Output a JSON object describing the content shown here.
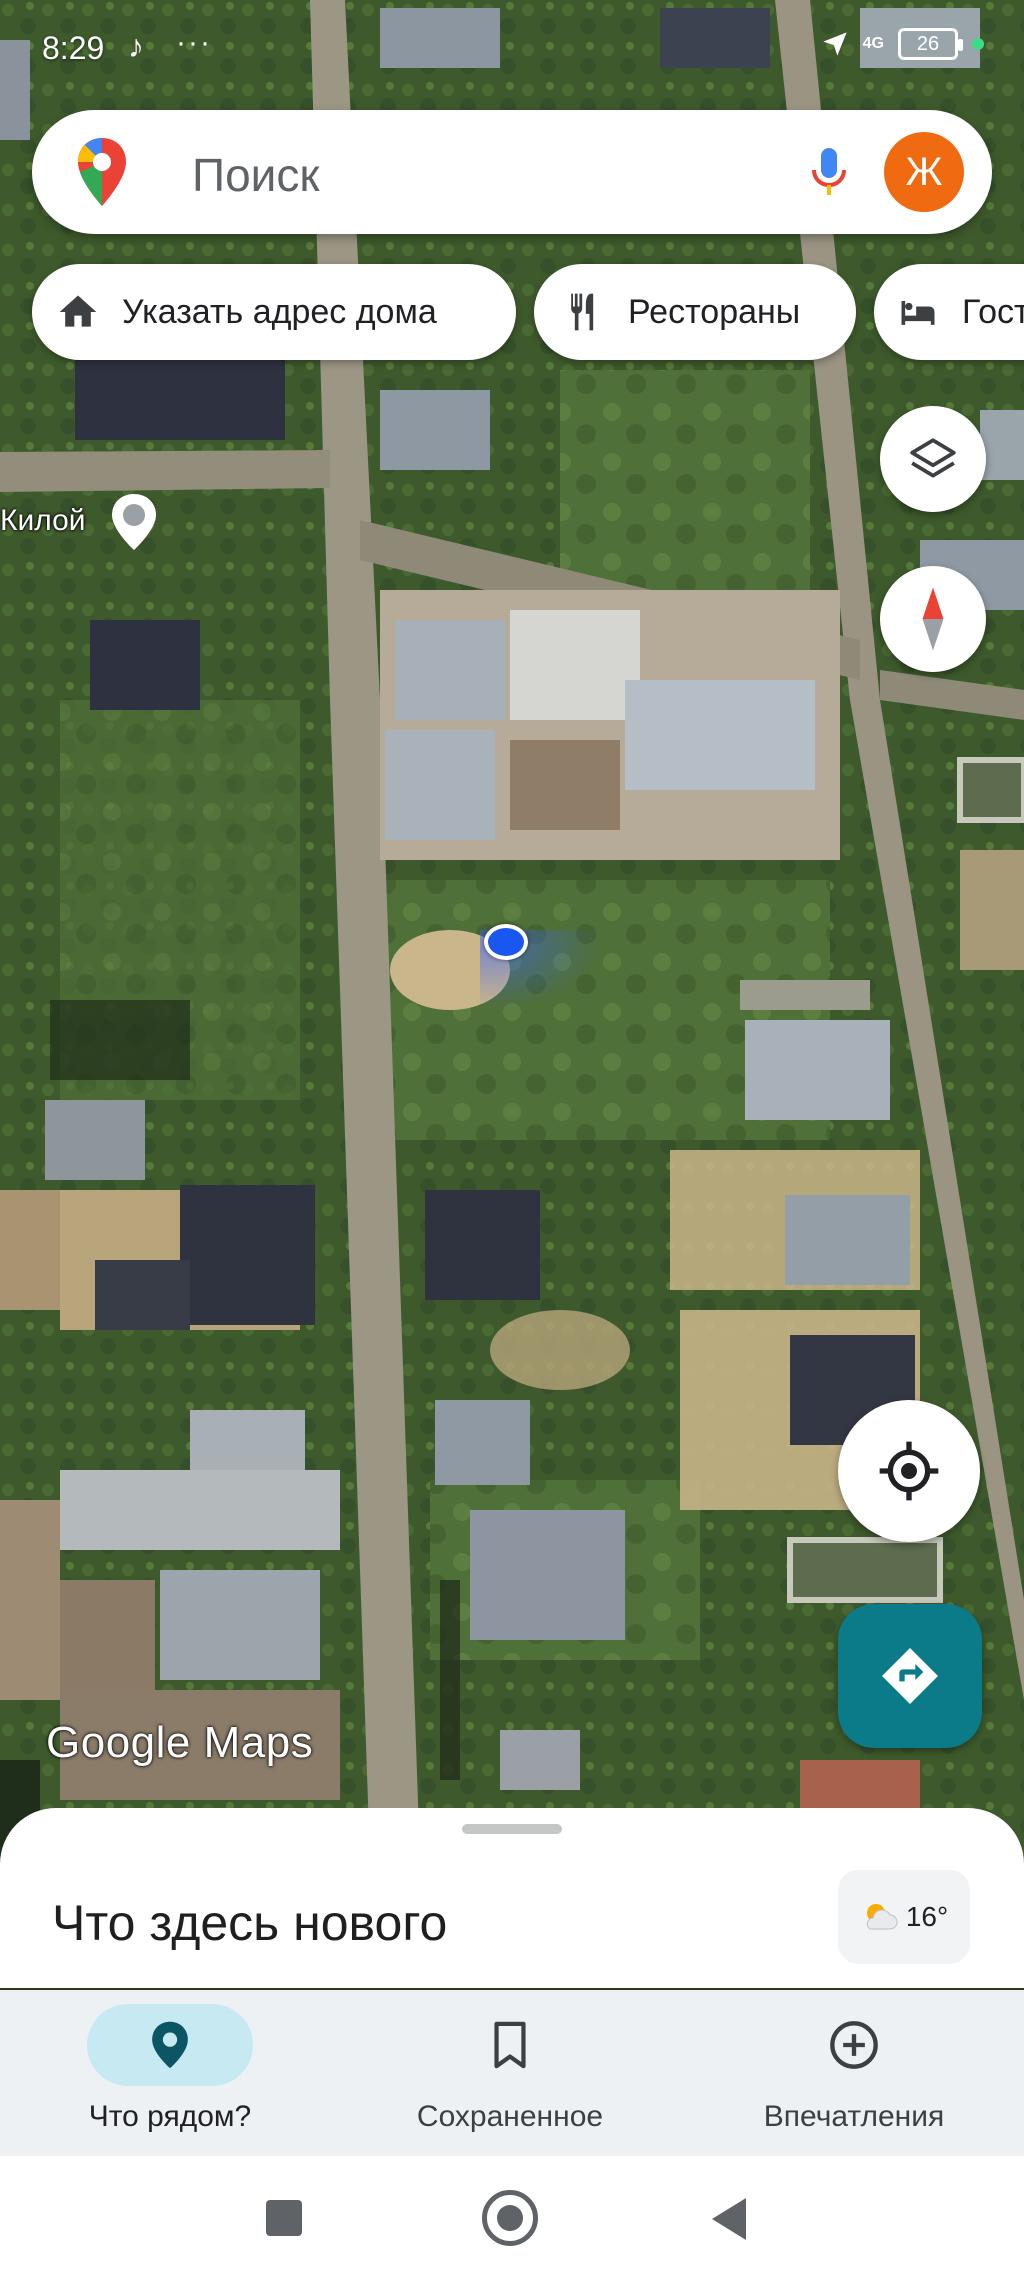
{
  "status_bar": {
    "time": "8:29",
    "dots": "···",
    "network": "4G",
    "battery": "26"
  },
  "search": {
    "placeholder": "Поиск",
    "avatar_letter": "Ж"
  },
  "chips": [
    {
      "label": "Указать адрес дома",
      "icon": "home-icon"
    },
    {
      "label": "Рестораны",
      "icon": "fork-knife-icon"
    },
    {
      "label": "Гост",
      "icon": "bed-icon"
    }
  ],
  "map": {
    "place_label": "Килой",
    "logo": "Google Maps"
  },
  "sheet": {
    "title": "Что здесь нового",
    "weather_temp": "16°",
    "weather_icon": "partly-cloudy-icon"
  },
  "bottom_nav": [
    {
      "label": "Что рядом?",
      "icon": "location-pin-icon",
      "active": true
    },
    {
      "label": "Сохраненное",
      "icon": "bookmark-icon",
      "active": false
    },
    {
      "label": "Впечатления",
      "icon": "add-circle-icon",
      "active": false
    }
  ],
  "colors": {
    "accent": "#0b7b8a",
    "active_pill": "#c6e9f2",
    "avatar": "#f06a12",
    "location_dot": "#1a56f0"
  }
}
